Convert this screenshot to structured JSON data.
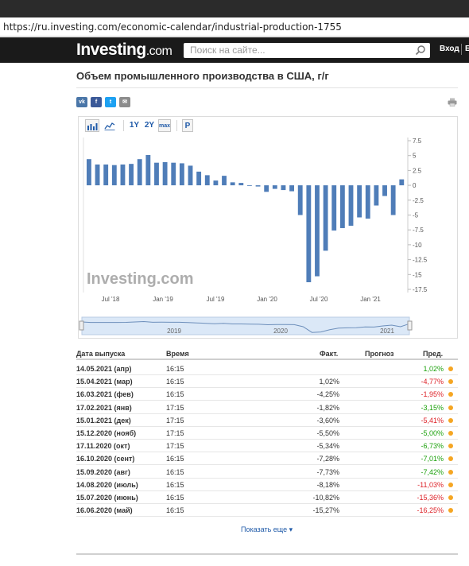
{
  "browser": {
    "url": "https://ru.investing.com/economic-calendar/industrial-production-1755"
  },
  "header": {
    "logo_main": "Investing",
    "logo_suffix": ".com",
    "search_placeholder": "Поиск на сайте...",
    "login_label": "Вход",
    "extra_label": "Б"
  },
  "page": {
    "title": "Объем промышленного производства в США, г/г"
  },
  "social": [
    {
      "icon": "vk-icon",
      "label": "vk",
      "color": "#4a76a8"
    },
    {
      "icon": "facebook-icon",
      "label": "f",
      "color": "#3b5998"
    },
    {
      "icon": "twitter-icon",
      "label": "t",
      "color": "#1da1f2"
    },
    {
      "icon": "mail-icon",
      "label": "✉",
      "color": "#8c8c8c"
    }
  ],
  "toolbar": {
    "btn_1y": "1Y",
    "btn_2y": "2Y",
    "btn_max": "max",
    "btn_p": "P"
  },
  "chart_data": {
    "type": "bar",
    "series": [
      {
        "values": [
          4.4,
          3.5,
          3.5,
          3.4,
          3.5,
          3.6,
          4.4,
          5.1,
          3.8,
          3.9,
          3.8,
          3.7,
          3.3,
          2.3,
          1.7,
          0.8,
          1.6,
          0.5,
          0.4,
          0.0,
          -0.2,
          -1.1,
          -0.6,
          -0.8,
          -1.0,
          -5.0,
          -16.3,
          -15.3,
          -11.0,
          -7.6,
          -7.2,
          -6.8,
          -5.4,
          -5.6,
          -3.4,
          -1.8,
          -5.0,
          1.0
        ]
      }
    ],
    "x_tick_labels": [
      "Jul '18",
      "Jan '19",
      "Jul '19",
      "Jan '20",
      "Jul '20",
      "Jan '21"
    ],
    "y_ticks": [
      7.5,
      5,
      2.5,
      0,
      -2.5,
      -5,
      -7.5,
      -10,
      -12.5,
      -15,
      -17.5
    ],
    "ylim": [
      -17.5,
      7.5
    ],
    "bar_color": "#4f7db8",
    "watermark": "Investing.com",
    "navigator_years": [
      "2019",
      "2020",
      "2021"
    ],
    "grid": false
  },
  "table": {
    "headers": {
      "date": "Дата выпуска",
      "time": "Время",
      "fact": "Факт.",
      "forecast": "Прогноз",
      "prev": "Пред."
    },
    "rows": [
      {
        "date": "14.05.2021 (апр)",
        "time": "16:15",
        "fact": "",
        "prev": "1,02%",
        "prev_color": "green"
      },
      {
        "date": "15.04.2021 (мар)",
        "time": "16:15",
        "fact": "1,02%",
        "prev": "-4,77%",
        "prev_color": "red"
      },
      {
        "date": "16.03.2021 (фев)",
        "time": "16:15",
        "fact": "-4,25%",
        "prev": "-1,95%",
        "prev_color": "red"
      },
      {
        "date": "17.02.2021 (янв)",
        "time": "17:15",
        "fact": "-1,82%",
        "prev": "-3,15%",
        "prev_color": "green"
      },
      {
        "date": "15.01.2021 (дек)",
        "time": "17:15",
        "fact": "-3,60%",
        "prev": "-5,41%",
        "prev_color": "red"
      },
      {
        "date": "15.12.2020 (нояб)",
        "time": "17:15",
        "fact": "-5,50%",
        "prev": "-5,00%",
        "prev_color": "green"
      },
      {
        "date": "17.11.2020 (окт)",
        "time": "17:15",
        "fact": "-5,34%",
        "prev": "-6,73%",
        "prev_color": "green"
      },
      {
        "date": "16.10.2020 (сент)",
        "time": "16:15",
        "fact": "-7,28%",
        "prev": "-7,01%",
        "prev_color": "green"
      },
      {
        "date": "15.09.2020 (авг)",
        "time": "16:15",
        "fact": "-7,73%",
        "prev": "-7,42%",
        "prev_color": "green"
      },
      {
        "date": "14.08.2020 (июль)",
        "time": "16:15",
        "fact": "-8,18%",
        "prev": "-11,03%",
        "prev_color": "red"
      },
      {
        "date": "15.07.2020 (июнь)",
        "time": "16:15",
        "fact": "-10,82%",
        "prev": "-15,36%",
        "prev_color": "red"
      },
      {
        "date": "16.06.2020 (май)",
        "time": "16:15",
        "fact": "-15,27%",
        "prev": "-16,25%",
        "prev_color": "red"
      }
    ],
    "show_more": "Показать еще"
  }
}
